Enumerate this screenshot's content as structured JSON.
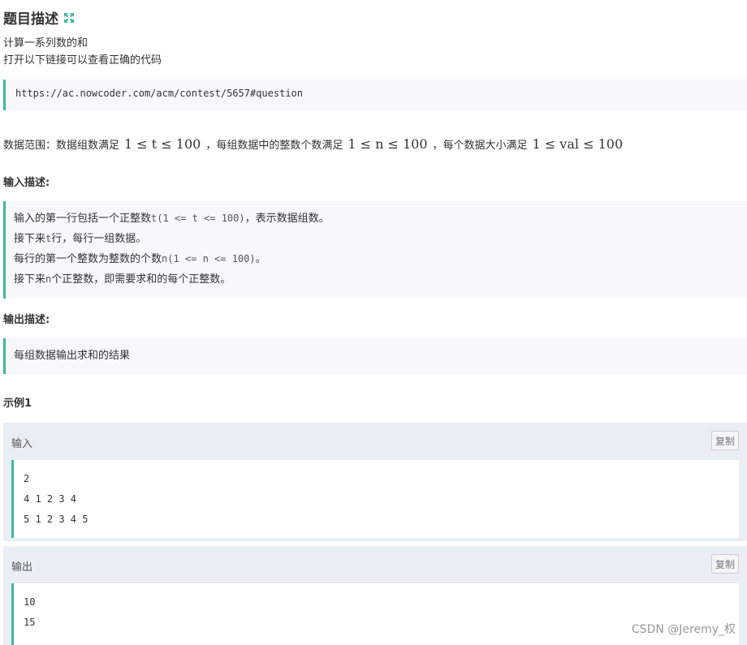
{
  "title": "题目描述",
  "icons": {
    "expand": "expand-icon"
  },
  "accent_color": "#3cb99a",
  "description": [
    "计算一系列数的和",
    "打开以下链接可以查看正确的代码"
  ],
  "url": "https://ac.nowcoder.com/acm/contest/5657#question",
  "range": {
    "prefix": "数据范围：数据组数满足",
    "mid1": "，每组数据中的整数个数满足",
    "mid2": "，每个数据大小满足",
    "math1": "1 ≤ t ≤ 100",
    "math2": "1 ≤ n ≤ 100",
    "math3": "1 ≤ val ≤ 100"
  },
  "input_label": "输入描述:",
  "input_lines": [
    {
      "pre": "输入的第一行包括一个正整数",
      "code": "t(1 <= t <= 100)",
      "post": "，表示数据组数。"
    },
    {
      "pre": "接下来",
      "code": "t",
      "post": "行，每行一组数据。"
    },
    {
      "pre": "每行的第一个整数为整数的个数",
      "code": "n(1 <= n <= 100)",
      "post": "。"
    },
    {
      "pre": "接下来",
      "code": "n",
      "post": "个正整数，即需要求和的每个正整数。"
    }
  ],
  "output_label": "输出描述:",
  "output_text": "每组数据输出求和的结果",
  "example_label": "示例1",
  "example_input_label": "输入",
  "example_output_label": "输出",
  "copy_label": "复制",
  "example_input_lines": [
    "2",
    "4 1 2 3 4",
    "5 1 2 3 4 5"
  ],
  "example_output_lines": [
    "10",
    "15"
  ],
  "watermark": "CSDN @Jeremy_权"
}
